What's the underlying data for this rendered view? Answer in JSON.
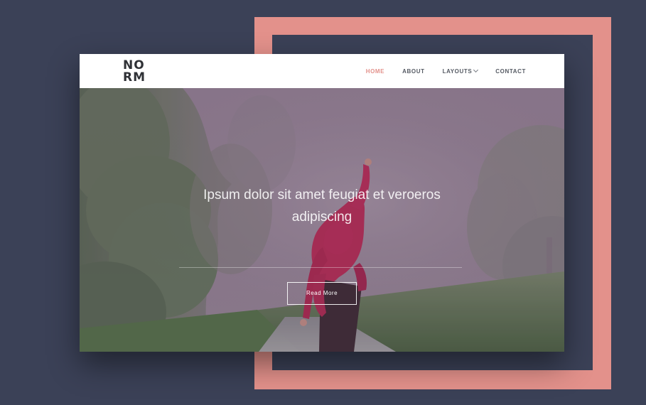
{
  "logo": {
    "line1": "NO",
    "line2": "RM"
  },
  "nav": {
    "items": [
      {
        "label": "HOME",
        "active": true
      },
      {
        "label": "ABOUT"
      },
      {
        "label": "LAYOUTS"
      },
      {
        "label": "CONTACT"
      }
    ]
  },
  "hero": {
    "headline": "Ipsum dolor sit amet feugiat et veroeros adipiscing",
    "button_label": "Read More"
  },
  "colors": {
    "background": "#3b4157",
    "accent": "#e3918b",
    "nav_active": "#e3918b"
  }
}
